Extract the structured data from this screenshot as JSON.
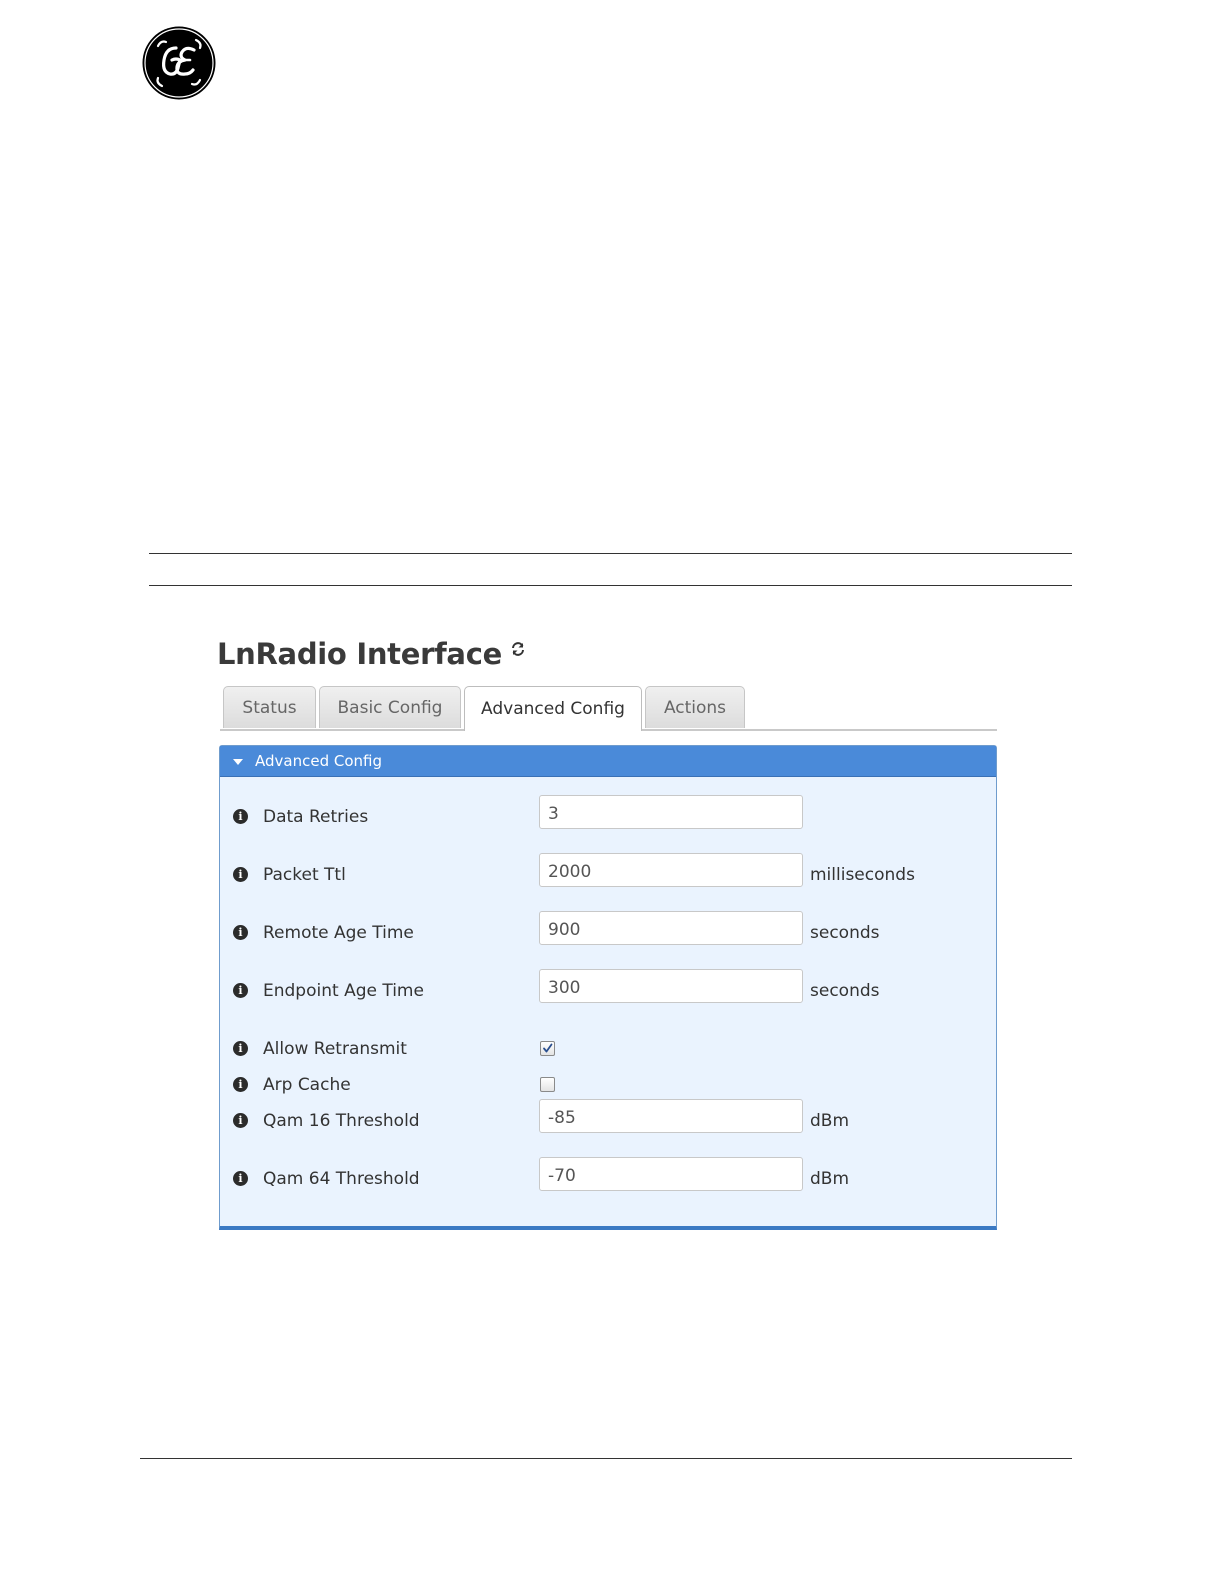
{
  "logo": {
    "name": "ge-monogram-logo"
  },
  "window": {
    "title": "LnRadio Interface",
    "refresh_icon": "refresh-icon"
  },
  "tabs": [
    {
      "label": "Status",
      "active": false
    },
    {
      "label": "Basic Config",
      "active": false
    },
    {
      "label": "Advanced Config",
      "active": true
    },
    {
      "label": "Actions",
      "active": false
    }
  ],
  "panel": {
    "title": "Advanced Config",
    "header_color": "#4a8ad9",
    "body_color": "#eaf3fe",
    "fields": [
      {
        "label": "Data Retries",
        "type": "text",
        "value": "3",
        "unit": ""
      },
      {
        "label": "Packet Ttl",
        "type": "text",
        "value": "2000",
        "unit": "milliseconds"
      },
      {
        "label": "Remote Age Time",
        "type": "text",
        "value": "900",
        "unit": "seconds"
      },
      {
        "label": "Endpoint Age Time",
        "type": "text",
        "value": "300",
        "unit": "seconds"
      },
      {
        "label": "Allow Retransmit",
        "type": "checkbox",
        "checked": true
      },
      {
        "label": "Arp Cache",
        "type": "checkbox",
        "checked": false
      },
      {
        "label": "Qam 16 Threshold",
        "type": "text",
        "value": "-85",
        "unit": "dBm"
      },
      {
        "label": "Qam 64 Threshold",
        "type": "text",
        "value": "-70",
        "unit": "dBm"
      }
    ]
  }
}
